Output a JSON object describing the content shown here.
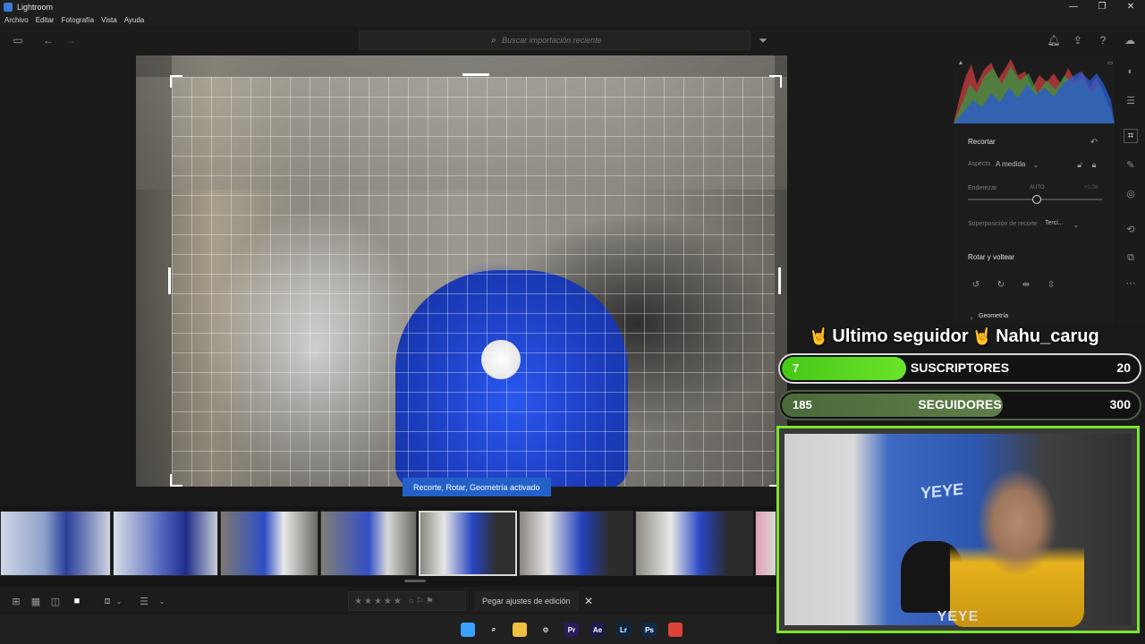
{
  "window": {
    "title": "Lightroom",
    "controls": {
      "minimize": "—",
      "maximize": "❐",
      "close": "✕"
    }
  },
  "menu": [
    "Archivo",
    "Editar",
    "Fotografía",
    "Vista",
    "Ayuda"
  ],
  "toolbar": {
    "search_placeholder": "Buscar importación reciente",
    "icons": [
      "panel-toggle-icon",
      "back-arrow-icon",
      "forward-arrow-icon",
      "filter-icon",
      "bell-icon",
      "share-icon",
      "help-icon",
      "cloud-icon"
    ]
  },
  "photo": {
    "toast": "Recorte, Rotar, Geometría activado"
  },
  "edit_panel": {
    "section_title": "Recortar",
    "aspect_label": "Aspecto",
    "aspect_value": "A medida",
    "straighten_label": "Enderezar",
    "straighten_auto": "AUTO",
    "straighten_value": "+0,08",
    "overlay_label": "Superposición de recorte",
    "overlay_value": "Terci...",
    "rotate_title": "Rotar y voltear",
    "geometry_title": "Geometría"
  },
  "stream_overlay": {
    "follower_text": "Ultimo seguidor",
    "follower_name": "Nahu_carug",
    "emoji": "🤘",
    "goals": [
      {
        "label": "SUSCRIPTORES",
        "current": "7",
        "target": "20",
        "progress": 0.35
      },
      {
        "label": "SEGUIDORES",
        "current": "185",
        "target": "300",
        "progress": 0.62
      }
    ],
    "webcam_brand": "YEYE",
    "wall_logo": "YEYE"
  },
  "filmstrip": {
    "selected_index": 4,
    "thumb_count": 8
  },
  "bottom_bar": {
    "stars": [
      "★",
      "★",
      "★",
      "★",
      "★"
    ],
    "paste_label": "Pegar ajustes de edición",
    "close_symbol": "✕"
  },
  "taskbar": {
    "apps": [
      {
        "name": "windows-start-icon",
        "label": "",
        "color": "#3aa0ff"
      },
      {
        "name": "search-icon",
        "label": "⌕",
        "color": "#202020"
      },
      {
        "name": "file-explorer-icon",
        "label": "",
        "color": "#f0c040"
      },
      {
        "name": "settings-icon",
        "label": "⚙",
        "color": "#202020"
      },
      {
        "name": "premiere-icon",
        "label": "Pr",
        "color": "#2b1a5a"
      },
      {
        "name": "after-effects-icon",
        "label": "Ae",
        "color": "#1c1a4a"
      },
      {
        "name": "lightroom-icon",
        "label": "Lr",
        "color": "#0c2642"
      },
      {
        "name": "photoshop-icon",
        "label": "Ps",
        "color": "#0d2a4a"
      },
      {
        "name": "chrome-icon",
        "label": "",
        "color": "#db4437"
      }
    ]
  },
  "colors": {
    "accent_blue": "#2361c8",
    "goal_green": "#46c818",
    "webcam_border": "#7ae52a"
  }
}
